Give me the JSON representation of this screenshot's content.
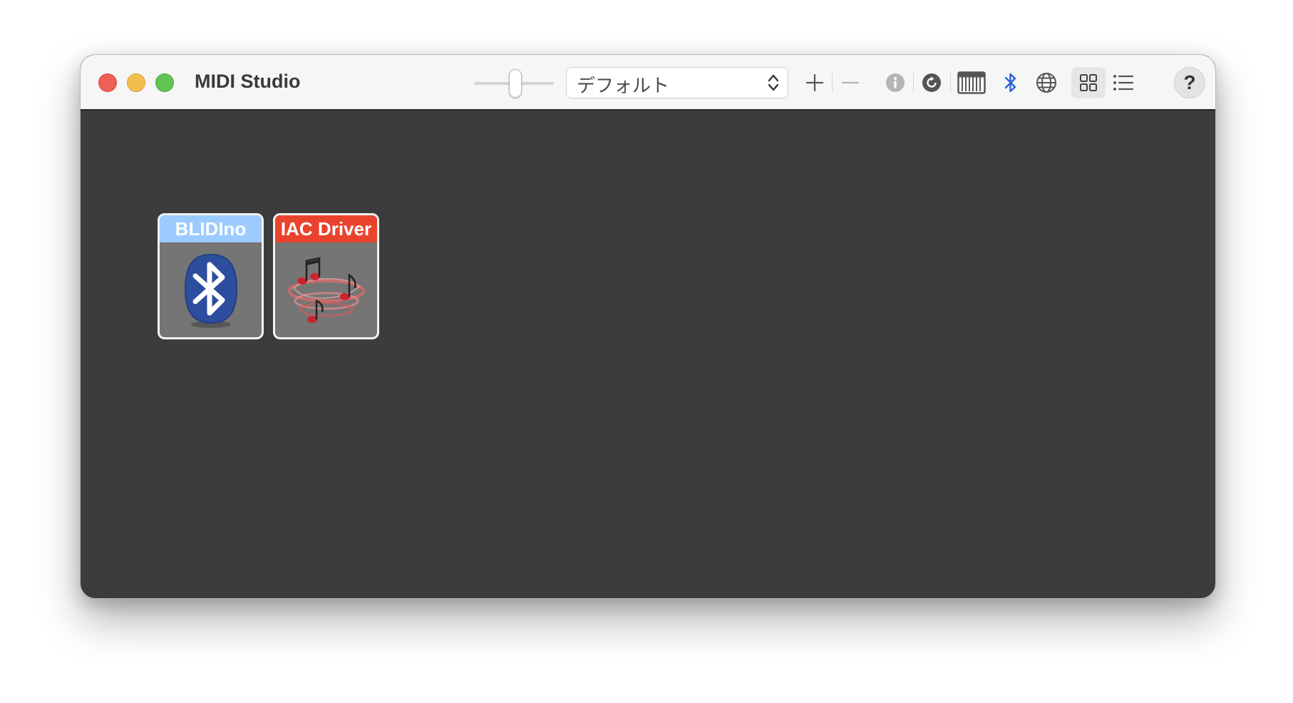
{
  "window": {
    "title": "MIDI Studio"
  },
  "toolbar": {
    "configuration": {
      "selected": "デフォルト"
    },
    "icons": [
      "zoom-slider",
      "add-icon",
      "remove-icon",
      "info-icon",
      "rescan-icon",
      "piano-keyboard-icon",
      "bluetooth-icon",
      "network-globe-icon",
      "grid-view-icon",
      "list-view-icon",
      "help-icon"
    ],
    "help_label": "?"
  },
  "devices": [
    {
      "label": "BLIDIno",
      "icon": "bluetooth-device-icon",
      "label_color": "#9ccbff"
    },
    {
      "label": "IAC Driver",
      "icon": "music-notes-icon",
      "label_color": "#e9432e"
    }
  ],
  "colors": {
    "close": "#ee5f57",
    "minimize": "#f4bd4f",
    "maximize": "#5fc454",
    "desktop": "#3c3c3c",
    "bluetooth_blue": "#2b62d9"
  }
}
